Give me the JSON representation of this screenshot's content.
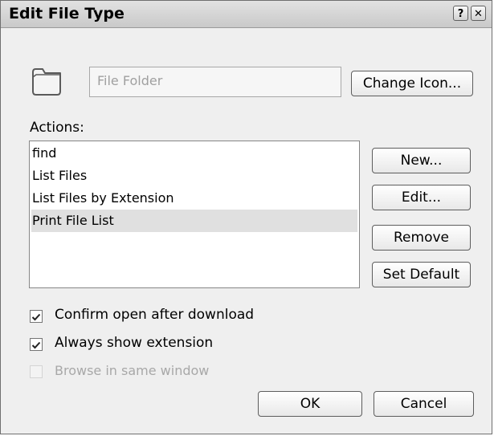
{
  "window": {
    "title": "Edit File Type",
    "help_glyph": "?",
    "close_glyph": "✕"
  },
  "file_type": {
    "icon": "folder-icon",
    "description_value": "File Folder",
    "change_icon_label": "Change Icon..."
  },
  "actions": {
    "label": "Actions:",
    "items": [
      {
        "label": "find",
        "selected": false
      },
      {
        "label": "List Files",
        "selected": false
      },
      {
        "label": "List Files by Extension",
        "selected": false
      },
      {
        "label": "Print File List",
        "selected": true
      }
    ],
    "buttons": {
      "new": "New...",
      "edit": "Edit...",
      "remove": "Remove",
      "set_default": "Set Default"
    }
  },
  "options": {
    "confirm_open": {
      "label": "Confirm open after download",
      "checked": true,
      "enabled": true
    },
    "always_show_extension": {
      "label": "Always show extension",
      "checked": true,
      "enabled": true
    },
    "browse_same_window": {
      "label": "Browse in same window",
      "checked": false,
      "enabled": false
    }
  },
  "footer": {
    "ok": "OK",
    "cancel": "Cancel"
  }
}
